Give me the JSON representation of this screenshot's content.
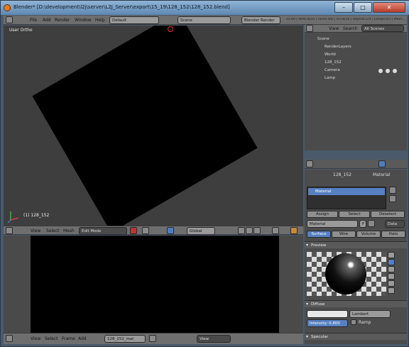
{
  "window": {
    "title": "Blender* [D:\\development\\l2j\\server\\L2J_Server\\export\\15_19\\128_152\\128_152.blend]",
    "minimize": "–",
    "maximize": "□",
    "close": "✕"
  },
  "info_header": {
    "menus": [
      "File",
      "Add",
      "Render",
      "Window",
      "Help"
    ],
    "layout": "Default",
    "scene": "Scene",
    "engine": "Blender Render",
    "stats": "v2.69 | Verts:8/16 | Faces:4/8 | Tris:8/16 | Objects:1/4 | Lamps:0/1 | Mem:..."
  },
  "viewport": {
    "label": "User Ortho",
    "object_label": "(1) 128_152",
    "header": {
      "menus": [
        "View",
        "Select",
        "Mesh"
      ],
      "mode": "Edit Mode",
      "pivot": "Global"
    }
  },
  "node_editor": {
    "menus": [
      "View",
      "Select",
      "Frame",
      "Add",
      "Node"
    ],
    "material": "128_152_mat",
    "view_mode": "View"
  },
  "outliner": {
    "tabs": [
      "View",
      "Search",
      "All Scenes"
    ],
    "items": [
      {
        "label": "Scene",
        "depth": 0
      },
      {
        "label": "RenderLayers",
        "depth": 1
      },
      {
        "label": "World",
        "depth": 1
      },
      {
        "label": "128_152",
        "depth": 1
      },
      {
        "label": "Camera",
        "depth": 1
      },
      {
        "label": "Lamp",
        "depth": 1
      }
    ]
  },
  "properties": {
    "breadcrumb": [
      "128_152",
      "Material"
    ],
    "slot": "Material",
    "slot_buttons": [
      "Assign",
      "Select",
      "Deselect"
    ],
    "material_name": "Material",
    "material_users": "F",
    "data_mode": "Data",
    "context_tabs": [
      "Surface",
      "Wire",
      "Volume",
      "Halo"
    ],
    "active_tab": "Surface",
    "panels": {
      "preview": "Preview",
      "diffuse": "Diffuse",
      "specular": "Specular"
    },
    "diffuse": {
      "shader": "Lambert",
      "intensity": "Intensity: 0.800",
      "ramp": "Ramp"
    }
  },
  "colors": {
    "accent": "#5680c2",
    "viewport_bg": "#3e3e3e",
    "header": "#6e6e6e"
  }
}
